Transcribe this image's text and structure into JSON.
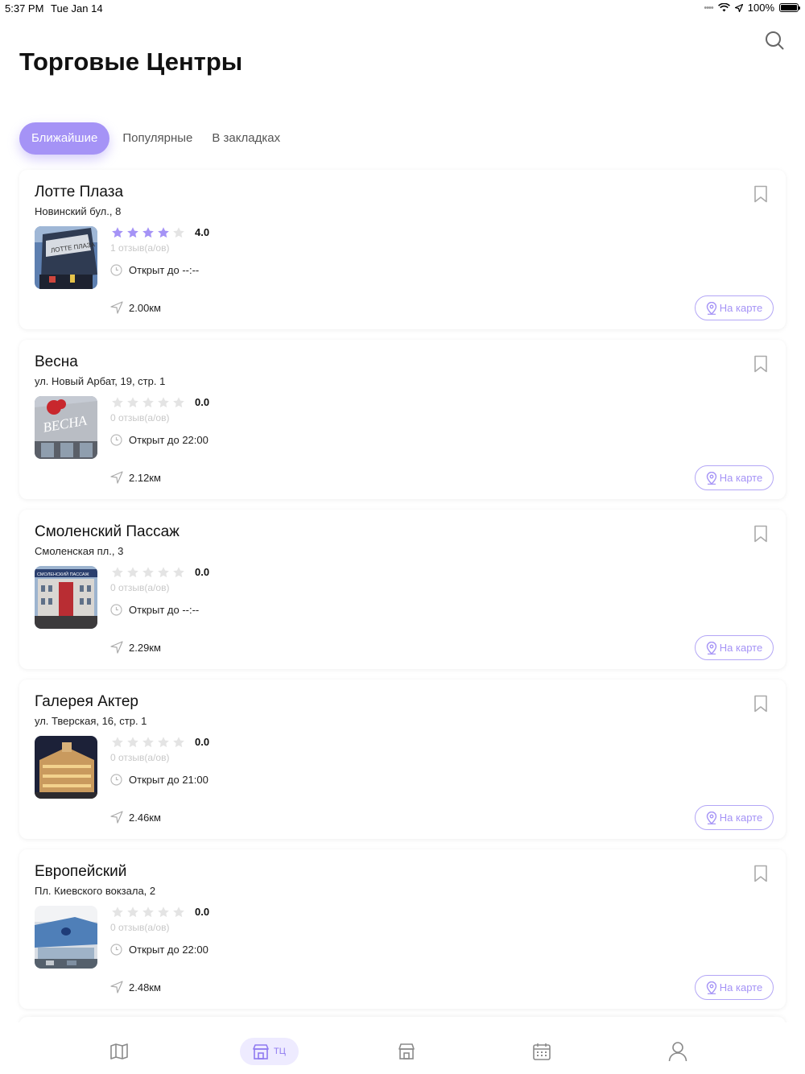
{
  "status": {
    "time": "5:37 PM",
    "date": "Tue Jan 14",
    "battery": "100%"
  },
  "header": {
    "title": "Торговые Центры",
    "search_icon": "search-icon"
  },
  "tabs": [
    {
      "label": "Ближайшие",
      "active": true
    },
    {
      "label": "Популярные",
      "active": false
    },
    {
      "label": "В закладках",
      "active": false
    }
  ],
  "colors": {
    "accent": "#a593f6",
    "star_filled": "#a593f6",
    "star_empty": "#e4e4e4"
  },
  "malls": [
    {
      "name": "Лотте Плаза",
      "address": "Новинский бул., 8",
      "stars": 4,
      "rating": "4.0",
      "reviews": "1 отзыв(а/ов)",
      "hours": "Открыт до --:--",
      "distance": "2.00км",
      "map_label": "На карте"
    },
    {
      "name": "Весна",
      "address": "ул. Новый Арбат, 19, стр. 1",
      "stars": 0,
      "rating": "0.0",
      "reviews": "0 отзыв(а/ов)",
      "hours": "Открыт до 22:00",
      "distance": "2.12км",
      "map_label": "На карте"
    },
    {
      "name": "Смоленский Пассаж",
      "address": "Смоленская пл., 3",
      "stars": 0,
      "rating": "0.0",
      "reviews": "0 отзыв(а/ов)",
      "hours": "Открыт до --:--",
      "distance": "2.29км",
      "map_label": "На карте"
    },
    {
      "name": "Галерея Актер",
      "address": "ул. Тверская, 16, стр. 1",
      "stars": 0,
      "rating": "0.0",
      "reviews": "0 отзыв(а/ов)",
      "hours": "Открыт до 21:00",
      "distance": "2.46км",
      "map_label": "На карте"
    },
    {
      "name": "Европейский",
      "address": "Пл. Киевского вокзала, 2",
      "stars": 0,
      "rating": "0.0",
      "reviews": "0 отзыв(а/ов)",
      "hours": "Открыт до 22:00",
      "distance": "2.48км",
      "map_label": "На карте"
    }
  ],
  "tabbar": [
    {
      "icon": "map-icon",
      "label": ""
    },
    {
      "icon": "mall-icon",
      "label": "ТЦ",
      "active": true
    },
    {
      "icon": "store-icon",
      "label": ""
    },
    {
      "icon": "calendar-icon",
      "label": ""
    },
    {
      "icon": "profile-icon",
      "label": ""
    }
  ]
}
